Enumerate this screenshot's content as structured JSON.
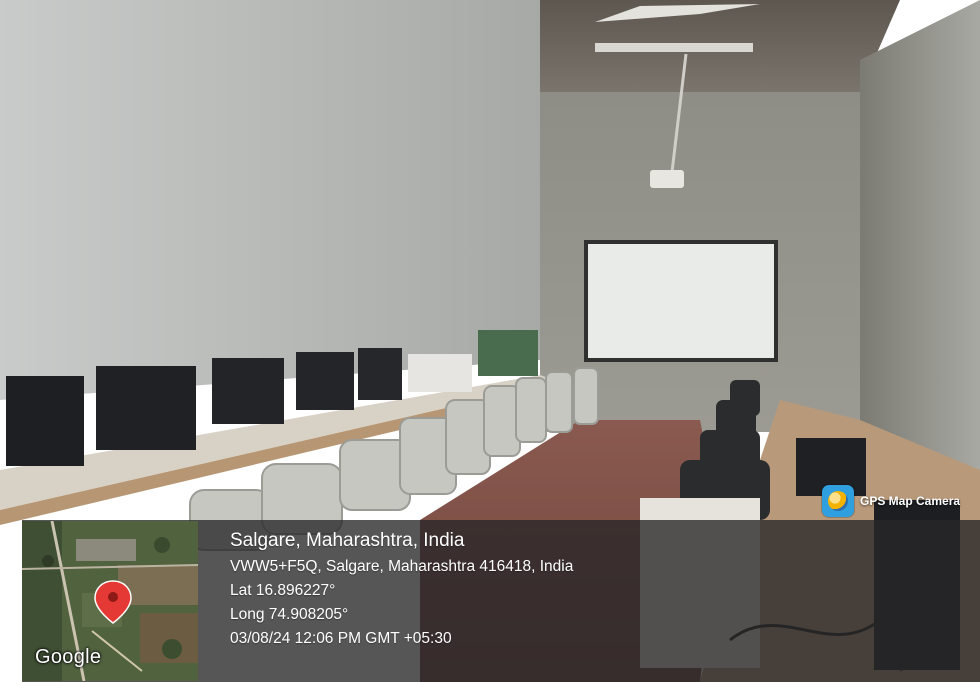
{
  "overlay": {
    "app_badge": {
      "label": "GPS Map Camera",
      "icon": "gps-map-camera-app-icon"
    },
    "map": {
      "provider_logo": "Google",
      "pin_color": "#e53935"
    },
    "location": {
      "title": "Salgare, Maharashtra, India",
      "address": "VWW5+F5Q, Salgare, Maharashtra 416418, India",
      "latitude": "Lat 16.896227°",
      "longitude": "Long 74.908205°",
      "datetime": "03/08/24 12:06 PM GMT +05:30"
    }
  }
}
